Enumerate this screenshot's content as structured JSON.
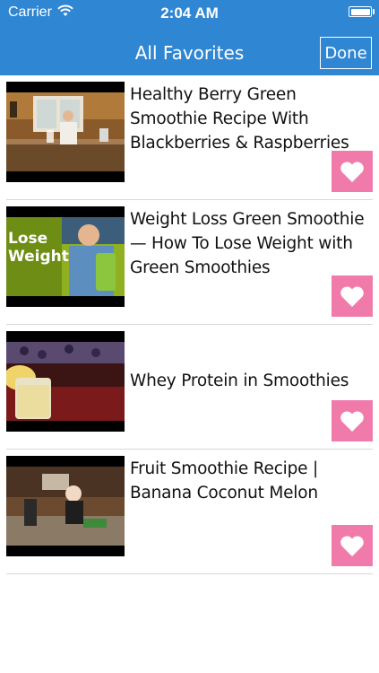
{
  "status_bar": {
    "carrier": "Carrier",
    "time": "2:04 AM"
  },
  "nav": {
    "title": "All Favorites",
    "done_label": "Done"
  },
  "favorites": [
    {
      "title": "Healthy Berry Green Smoothie Recipe With Blackberries & Raspberries"
    },
    {
      "title": "Weight Loss Green Smoothie — How To Lose Weight with Green Smoothies",
      "thumb_text_line1": "Lose",
      "thumb_text_line2": "Weight"
    },
    {
      "title": "Whey Protein in Smoothies"
    },
    {
      "title": "Fruit Smoothie Recipe | Banana Coconut Melon"
    }
  ],
  "colors": {
    "nav_bar": "#2f86d3",
    "heart_button": "#f07bab",
    "divider": "#d8d8d8"
  },
  "icons": {
    "favorite": "heart-icon",
    "signal": "wifi-icon",
    "power": "battery-icon"
  }
}
